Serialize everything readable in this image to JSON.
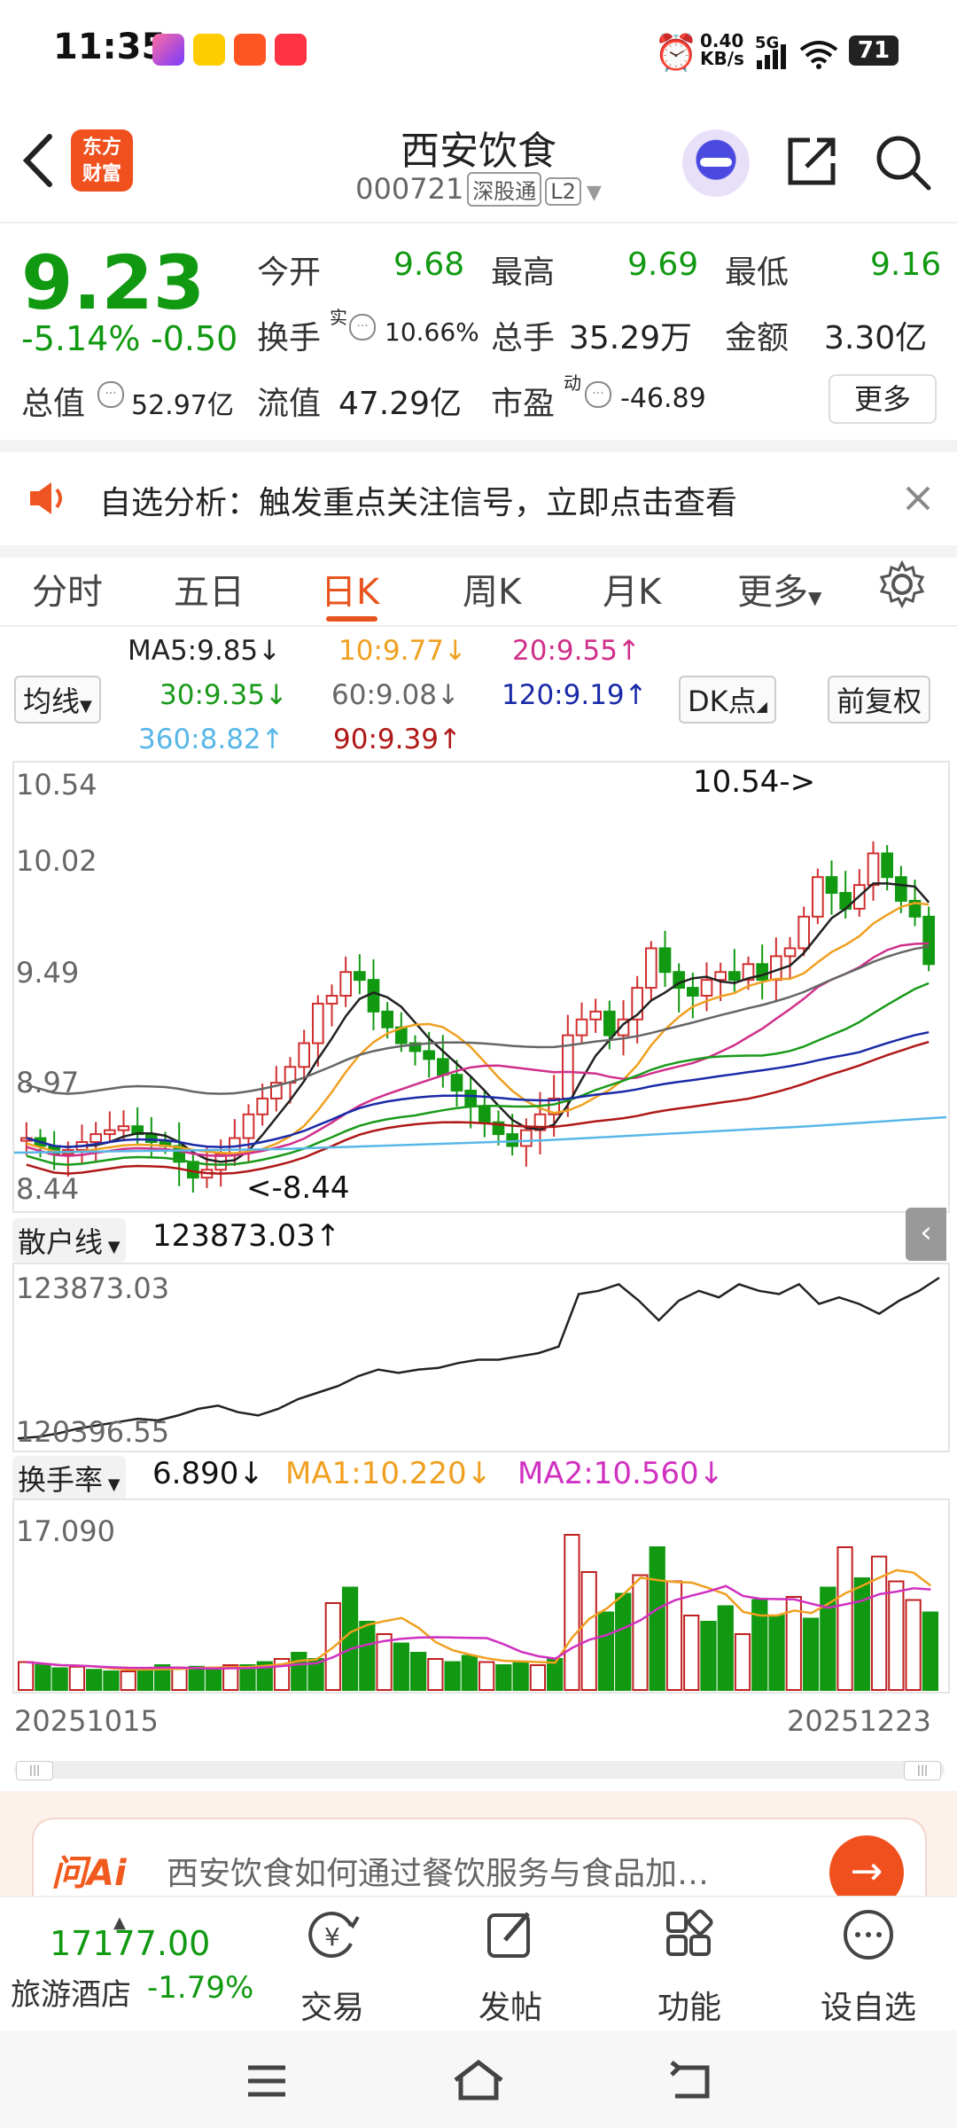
{
  "status_bar": {
    "time": "11:35",
    "speed": "0.40",
    "speed_unit": "KB/s",
    "net": "5G",
    "battery": "71"
  },
  "header": {
    "title": "西安饮食",
    "code": "000721",
    "tag1": "深股通",
    "tag2": "L2",
    "logo_text": "东方财富"
  },
  "quote": {
    "price": "9.23",
    "pct": "-5.14%",
    "chg": "-0.50",
    "open_label": "今开",
    "open": "9.68",
    "high_label": "最高",
    "high": "9.69",
    "low_label": "最低",
    "low": "9.16",
    "turnover_label": "换手",
    "turnover_sup": "实",
    "turnover": "10.66%",
    "vol_label": "总手",
    "vol": "35.29万",
    "amount_label": "金额",
    "amount": "3.30亿",
    "mktcap_label": "总值",
    "mktcap": "52.97亿",
    "float_label": "流值",
    "float": "47.29亿",
    "pe_label": "市盈",
    "pe_sup": "动",
    "pe": "-46.89",
    "more": "更多"
  },
  "banner": {
    "text": "自选分析：触发重点关注信号，立即点击查看"
  },
  "tabs": [
    {
      "label": "分时"
    },
    {
      "label": "五日"
    },
    {
      "label": "日K"
    },
    {
      "label": "周K"
    },
    {
      "label": "月K"
    },
    {
      "label": "更多"
    }
  ],
  "ma_legend": {
    "button": "均线",
    "ma5": "MA5:9.85↓",
    "ma10": "10:9.77↓",
    "ma20": "20:9.55↑",
    "ma30": "30:9.35↓",
    "ma60": "60:9.08↓",
    "ma120": "120:9.19↑",
    "ma360": "360:8.82↑",
    "ma90": "90:9.39↑",
    "dk": "DK点",
    "fq": "前复权",
    "colors": {
      "ma5": "#222222",
      "ma10": "#f0a020",
      "ma20": "#d0308a",
      "ma30": "#1a9a1a",
      "ma60": "#666666",
      "ma120": "#1a2aa8",
      "ma360": "#59b7e8",
      "ma90": "#b01818"
    }
  },
  "kchart": {
    "y_labels": [
      "10.54",
      "10.02",
      "9.49",
      "8.97",
      "8.44"
    ],
    "high_note": "10.54->",
    "low_note": "<-8.44",
    "retail_label": "散户线",
    "retail_value": "123873.03↑",
    "retail_max": "123873.03",
    "retail_min": "120396.55",
    "turn_label": "换手率",
    "turn_value": "6.890↓",
    "turn_ma1": "MA1:10.220↓",
    "turn_ma2": "MA2:10.560↓",
    "turn_max": "17.090",
    "date_start": "20251015",
    "date_end": "20251223"
  },
  "ai_bar": {
    "label": "问Ai",
    "text": "西安饮食如何通过餐饮服务与食品加…"
  },
  "bottom": {
    "index_value": "17177.00",
    "index_name": "旅游酒店",
    "index_pct": "-1.79%",
    "items": [
      "交易",
      "发帖",
      "功能",
      "设自选"
    ]
  }
}
